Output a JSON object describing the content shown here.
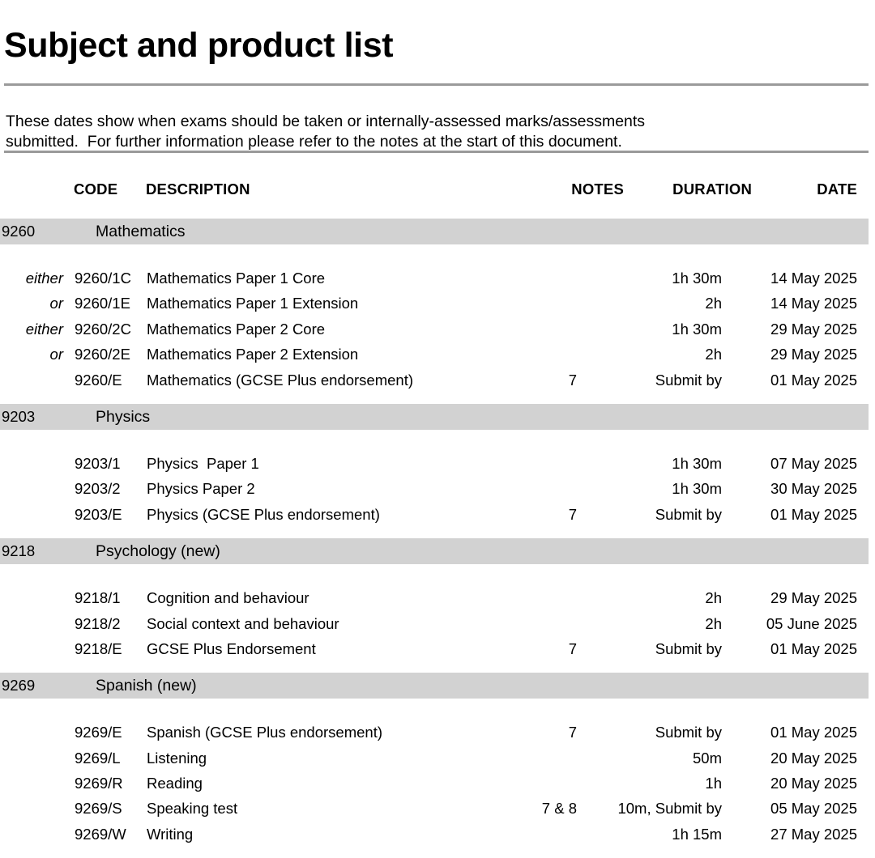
{
  "document": {
    "title": "Subject and product list",
    "intro": "These dates show when exams should be taken or internally-assessed marks/assessments\nsubmitted.  For further information please refer to the notes at the start of this document.",
    "rule_color": "#9a9a9a",
    "band_color": "#d2d2d2"
  },
  "table": {
    "headers": {
      "code": "CODE",
      "description": "DESCRIPTION",
      "notes": "NOTES",
      "duration": "DURATION",
      "date": "DATE"
    },
    "sections": [
      {
        "code": "9260",
        "name": "Mathematics",
        "rows": [
          {
            "either": "either",
            "code": "9260/1C",
            "description": "Mathematics Paper 1 Core",
            "notes": "",
            "duration": "1h 30m",
            "date": "14 May 2025"
          },
          {
            "either": "or",
            "code": "9260/1E",
            "description": "Mathematics Paper 1 Extension",
            "notes": "",
            "duration": "2h",
            "date": "14 May 2025"
          },
          {
            "either": "either",
            "code": "9260/2C",
            "description": "Mathematics Paper 2 Core",
            "notes": "",
            "duration": "1h 30m",
            "date": "29 May 2025"
          },
          {
            "either": "or",
            "code": "9260/2E",
            "description": "Mathematics Paper 2 Extension",
            "notes": "",
            "duration": "2h",
            "date": "29 May 2025"
          },
          {
            "either": "",
            "code": "9260/E",
            "description": "Mathematics (GCSE Plus endorsement)",
            "notes": "7",
            "duration": "Submit by",
            "date": "01 May 2025"
          }
        ]
      },
      {
        "code": "9203",
        "name": "Physics",
        "rows": [
          {
            "either": "",
            "code": "9203/1",
            "description": "Physics  Paper 1",
            "notes": "",
            "duration": "1h 30m",
            "date": "07 May 2025"
          },
          {
            "either": "",
            "code": "9203/2",
            "description": "Physics Paper 2",
            "notes": "",
            "duration": "1h 30m",
            "date": "30 May 2025"
          },
          {
            "either": "",
            "code": "9203/E",
            "description": "Physics (GCSE Plus endorsement)",
            "notes": "7",
            "duration": "Submit by",
            "date": "01 May 2025"
          }
        ]
      },
      {
        "code": "9218",
        "name": "Psychology (new)",
        "rows": [
          {
            "either": "",
            "code": "9218/1",
            "description": "Cognition and behaviour",
            "notes": "",
            "duration": "2h",
            "date": "29 May 2025"
          },
          {
            "either": "",
            "code": "9218/2",
            "description": "Social context and behaviour",
            "notes": "",
            "duration": "2h",
            "date": "05 June 2025"
          },
          {
            "either": "",
            "code": "9218/E",
            "description": "GCSE Plus Endorsement",
            "notes": "7",
            "duration": "Submit by",
            "date": "01 May 2025"
          }
        ]
      },
      {
        "code": "9269",
        "name": "Spanish (new)",
        "rows": [
          {
            "either": "",
            "code": "9269/E",
            "description": "Spanish (GCSE Plus endorsement)",
            "notes": "7",
            "duration": "Submit by",
            "date": "01 May 2025"
          },
          {
            "either": "",
            "code": "9269/L",
            "description": "Listening",
            "notes": "",
            "duration": "50m",
            "date": "20 May 2025"
          },
          {
            "either": "",
            "code": "9269/R",
            "description": "Reading",
            "notes": "",
            "duration": "1h",
            "date": "20 May 2025"
          },
          {
            "either": "",
            "code": "9269/S",
            "description": "Speaking test",
            "notes": "7 & 8",
            "duration": "10m, Submit by",
            "date": "05 May 2025"
          },
          {
            "either": "",
            "code": "9269/W",
            "description": "Writing",
            "notes": "",
            "duration": "1h 15m",
            "date": "27 May 2025"
          }
        ]
      }
    ]
  }
}
